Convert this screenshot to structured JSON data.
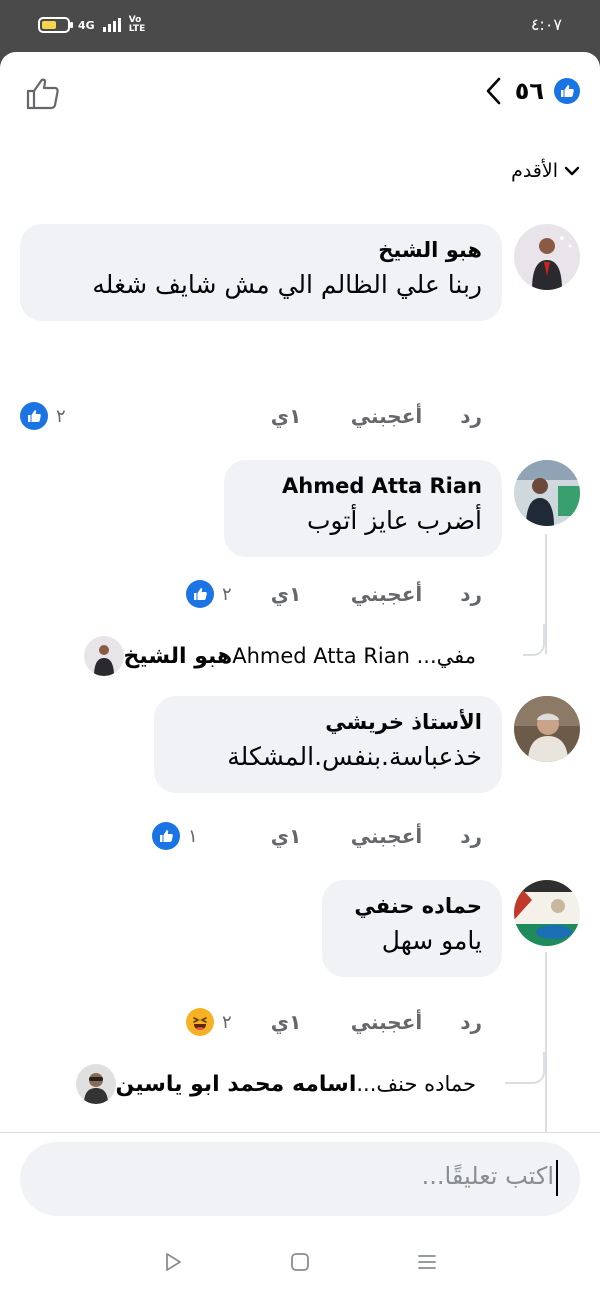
{
  "status_bar": {
    "clock": "٤:٠٧",
    "network": "4G",
    "volte": "Vo LTE"
  },
  "header": {
    "reaction_count": "٥٦",
    "icons": {
      "like_badge": "like-badge-icon",
      "back": "chevron-left-icon",
      "thumbs_up": "thumbs-up-icon"
    }
  },
  "sort": {
    "label": "الأقدم"
  },
  "actions_labels": {
    "time": "١ي",
    "like": "أعجبني",
    "reply": "رد"
  },
  "comments": [
    {
      "name": "هبو الشيخ",
      "text": "ربنا علي الظالم الي مش شايف شغله",
      "reaction_icon": "like",
      "reaction_count": "٢"
    },
    {
      "name": "Ahmed Atta Rian",
      "text": "أضرب عايز أتوب",
      "reaction_icon": "like",
      "reaction_count": "٢",
      "reply": {
        "name": "هبو الشيخ",
        "text": "مفي... Ahmed Atta Rian"
      }
    },
    {
      "name": "الأستاذ خريشي",
      "text": "خذعباسة.بنفس.المشكلة",
      "reaction_icon": "like",
      "reaction_count": "١"
    },
    {
      "name": "حماده حنفي",
      "text": "يامو سهل",
      "reaction_icon": "haha",
      "reaction_count": "٢",
      "reply": {
        "name": "اسامه محمد ابو ياسين",
        "text": "حماده حنف..."
      }
    }
  ],
  "composer": {
    "placeholder": "اكتب تعليقًا..."
  },
  "colors": {
    "accent": "#1b74e4",
    "bubble": "#f0f2f5",
    "text": "#050505",
    "muted": "#65676b",
    "haha": "#f7b125"
  },
  "navbar": {
    "icons": [
      "play-back-icon",
      "square-home-icon",
      "menu-lines-icon"
    ]
  }
}
